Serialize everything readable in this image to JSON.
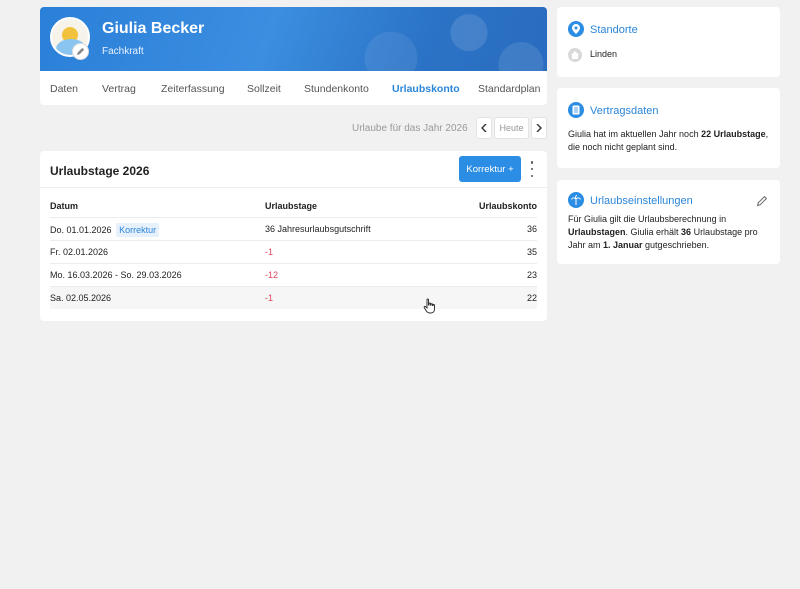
{
  "profile": {
    "name": "Giulia Becker",
    "role": "Fachkraft"
  },
  "tabs": [
    {
      "label": "Daten"
    },
    {
      "label": "Vertrag"
    },
    {
      "label": "Zeiterfassung"
    },
    {
      "label": "Sollzeit"
    },
    {
      "label": "Stundenkonto"
    },
    {
      "label": "Urlaubskonto",
      "active": true
    },
    {
      "label": "Standardplan"
    }
  ],
  "year_nav": {
    "label": "Urlaube für das Jahr 2026",
    "prev": "‹",
    "today": "Heute",
    "next": "›"
  },
  "vacation": {
    "title": "Urlaubstage 2026",
    "korrektur_button": "Korrektur +",
    "headers": {
      "date": "Datum",
      "days": "Urlaubstage",
      "account": "Urlaubskonto"
    },
    "rows": [
      {
        "date": "Do. 01.01.2026",
        "badge": "Korrektur",
        "days": "36",
        "note": "Jahresurlaubsgutschrift",
        "account": "36"
      },
      {
        "date": "Fr. 02.01.2026",
        "badge": "",
        "days": "-1",
        "note": "",
        "account": "35"
      },
      {
        "date": "Mo. 16.03.2026 - So. 29.03.2026",
        "badge": "",
        "days": "-12",
        "note": "",
        "account": "23"
      },
      {
        "date": "Sa. 02.05.2026",
        "badge": "",
        "days": "-1",
        "note": "",
        "account": "22"
      }
    ]
  },
  "sidebar": {
    "standorte": {
      "title": "Standorte",
      "location": "Linden"
    },
    "vertragsdaten": {
      "title": "Vertragsdaten",
      "t1": "Giulia hat im aktuellen Jahr noch ",
      "b1": "22 Urlaubstage",
      "t2": ", die noch nicht geplant sind."
    },
    "urlaubseinstellungen": {
      "title": "Urlaubseinstellungen",
      "t1": "Für Giulia gilt die Urlaubsberechnung in ",
      "b1": "Urlaubstagen",
      "t2": ". Giulia erhält ",
      "b2": "36",
      "t3": " Urlaubstage pro Jahr am ",
      "b3": "1. Januar",
      "t4": " gutgeschrieben."
    }
  },
  "colors": {
    "accent": "#2b8de3",
    "negative": "#e0435b",
    "positive": "#3aaa4a"
  }
}
